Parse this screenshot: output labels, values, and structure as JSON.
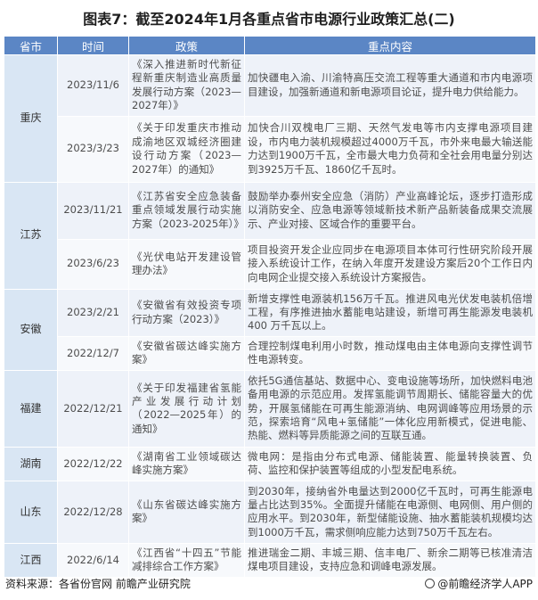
{
  "title": "图表7：截至2024年1月各重点省市电源行业政策汇总(二)",
  "headers": {
    "province": "省市",
    "time": "时间",
    "policy": "政策",
    "content": "重点内容"
  },
  "rows": [
    {
      "time": "2023/11/6",
      "policy": "《深入推进新时代新征程新重庆制造业高质量发展行动方案（2023—2027年）》",
      "content": "加快疆电入渝、川渝特高压交流工程等重大通道和市内电源项目建设，加强新通道和新电源项目论证，提升电力供给能力。"
    },
    {
      "time": "2023/3/23",
      "policy": "《关于印发重庆市推动成渝地区双城经济圈建设行动方案（2023—2027年）的通知》",
      "content": "加快合川双槐电厂三期、天然气发电等市内支撑电源项目建设，市内电力装机规模超过4000万千瓦，市外来电最大输送能力达到1900万千瓦，全市最大电力负荷和全社会用电量分别达到3925万千瓦、1860亿千瓦时。"
    },
    {
      "time": "2023/11/21",
      "policy": "《江苏省安全应急装备重点领域发展行动实施方案（2023-2025年）》",
      "content": "鼓励举办泰州安全应急（消防）产业高峰论坛，逐步打造形成以消防安全、应急电源等领域新技术新产品新装备成果交流展示、产业对接、区域合作的重要平台。"
    },
    {
      "time": "2023/6/23",
      "policy": "《光伏电站开发建设管理办法》",
      "content": "项目投资开发企业应同步在电源项目本体可行性研究阶段开展接入系统设计工作，在纳入年度开发建设方案后20个工作日内向电网企业提交接入系统设计方案报告。"
    },
    {
      "time": "2023/2/21",
      "policy": "《安徽省有效投资专项行动方案（2023）》",
      "content": "新增支撑性电源装机156万千瓦。推进风电光伏发电装机倍增工程，有序推进抽水蓄能电站建设，新增可再生能源发电装机400 万千瓦以上。"
    },
    {
      "time": "2022/12/7",
      "policy": "《安徽省碳达峰实施方案》",
      "content": "合理控制煤电利用小时数，推动煤电由主体电源向支撑性调节性电源转变。"
    },
    {
      "time": "2022/12/21",
      "policy": "《关于印发福建省氢能产业发展行动计划（2022—2025年）的通知》",
      "content": "依托5G通信基站、数据中心、变电设施等场所，加快燃料电池备用电源的示范应用。发挥氢能调节周期长、储能容量大的优势，开展氢储能在可再生能源消纳、电网调峰等应用场景的示范，探索培育“风电+氢储能”一体化应用新模式，促进电能、热能、燃料等异质能源之间的互联互通。"
    },
    {
      "time": "2022/12/22",
      "policy": "《湖南省工业领域碳达峰实施方案》",
      "content": "微电网：是指由分布式电源、储能装置、能量转换装置、负荷、监控和保护装置等组成的小型发配电系统。"
    },
    {
      "time": "2022/12/28",
      "policy": "《山东省碳达峰实施方案》",
      "content": "到2030年，接纳省外电量达到2000亿千瓦时，可再生能源电量占比达到35%。全面提升储能在电源侧、电网侧、用户侧的应用水平。到2030年，新型储能设施、抽水蓄能装机规模均达到1000万千瓦，需求侧响应能力达到750万千瓦左右。"
    },
    {
      "time": "2022/6/14",
      "policy": "《江西省“十四五”节能减排综合工作方案》",
      "content": "推进瑞金二期、丰城三期、信丰电厂、新余二期等已核准清洁煤电项目建设，支持应急和调峰电源发展。"
    }
  ],
  "provinces": [
    "重庆",
    "江苏",
    "安徽",
    "福建",
    "湖南",
    "山东",
    "江西"
  ],
  "footer": {
    "source": "资料来源：各省份官网 前瞻产业研究院",
    "brand": "@前瞻经济学人APP"
  },
  "colors": {
    "header_bg": "#5b86c5",
    "province_bg": "#d9e6f4",
    "cell_bg": "#eef2f9",
    "cell_alt_bg": "#f7f9fc"
  }
}
